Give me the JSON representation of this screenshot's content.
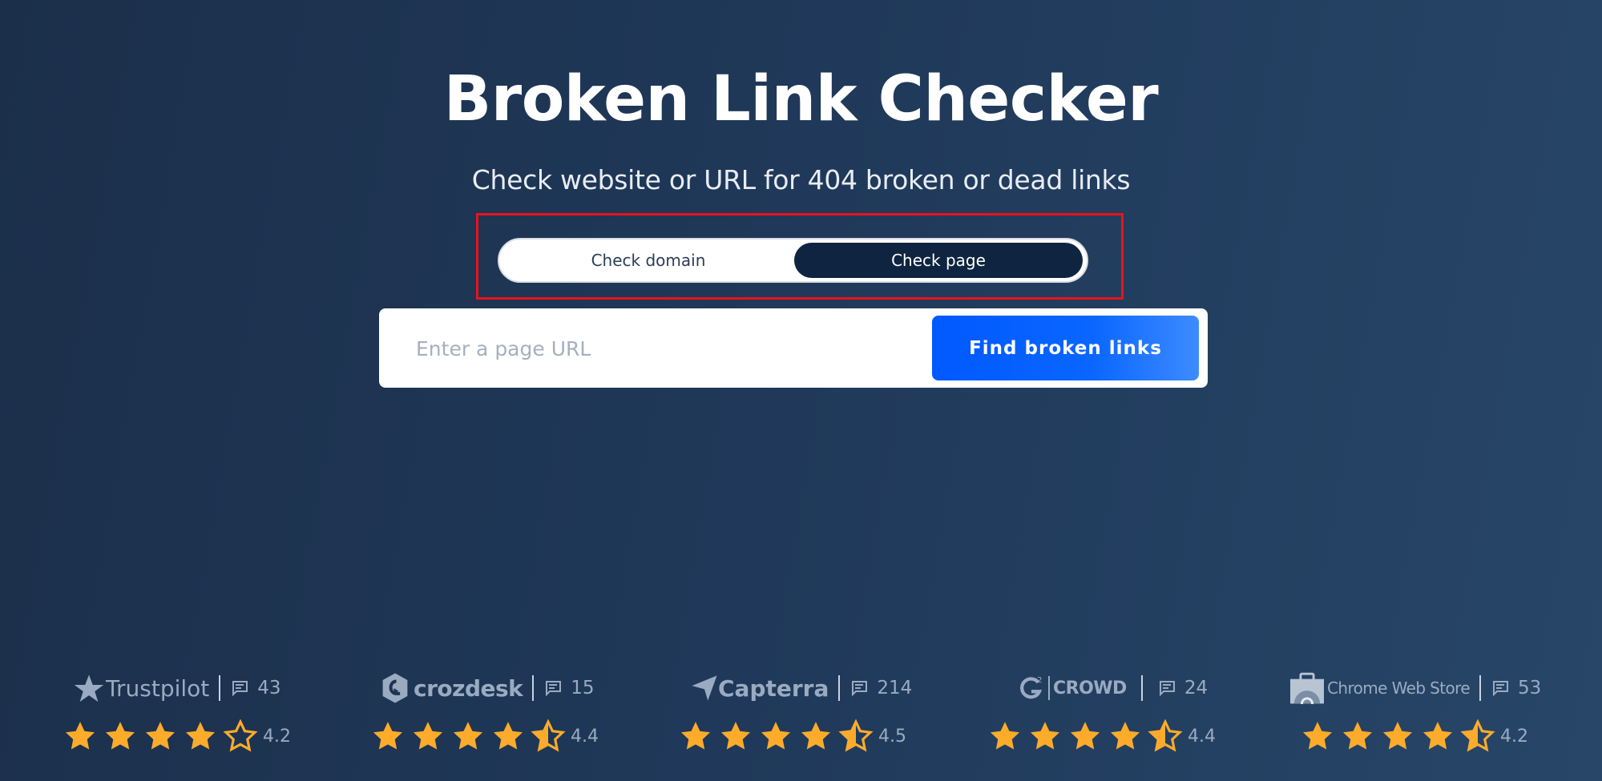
{
  "header": {
    "title": "Broken Link Checker",
    "subtitle": "Check website or URL for 404 broken or dead links"
  },
  "mode_toggle": {
    "options": [
      {
        "label": "Check domain",
        "selected": false
      },
      {
        "label": "Check page",
        "selected": true
      }
    ]
  },
  "search": {
    "placeholder": "Enter a page URL",
    "value": "",
    "button_label": "Find broken links"
  },
  "colors": {
    "star": "#fdab2b",
    "button": "#0a66ff",
    "highlight": "#e8131b",
    "toggle_active": "#0f2440"
  },
  "reviews": [
    {
      "platform": "Trustpilot",
      "logo_icon": "trustpilot-star-icon",
      "review_count": "43",
      "rating": "4.2",
      "rating_value": 4.2,
      "stars": [
        "full",
        "full",
        "full",
        "full",
        "empty"
      ]
    },
    {
      "platform": "crozdesk",
      "logo_icon": "crozdesk-logo-icon",
      "review_count": "15",
      "rating": "4.4",
      "rating_value": 4.4,
      "stars": [
        "full",
        "full",
        "full",
        "full",
        "half"
      ]
    },
    {
      "platform": "Capterra",
      "logo_icon": "capterra-arrow-icon",
      "review_count": "214",
      "rating": "4.5",
      "rating_value": 4.5,
      "stars": [
        "full",
        "full",
        "full",
        "full",
        "half"
      ]
    },
    {
      "platform": "CROWD",
      "logo_icon": "g2-logo-icon",
      "review_count": "24",
      "rating": "4.4",
      "rating_value": 4.4,
      "stars": [
        "full",
        "full",
        "full",
        "full",
        "half"
      ]
    },
    {
      "platform": "Chrome Web Store",
      "logo_icon": "chrome-web-store-icon",
      "review_count": "53",
      "rating": "4.2",
      "rating_value": 4.2,
      "stars": [
        "full",
        "full",
        "full",
        "full",
        "half"
      ]
    }
  ]
}
